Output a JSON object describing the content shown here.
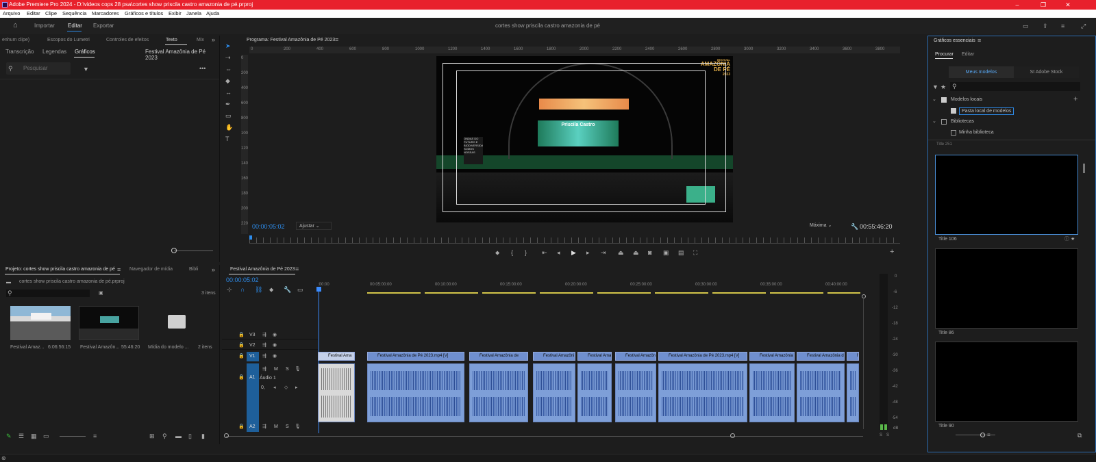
{
  "app": {
    "title": "Adobe Premiere Pro 2024 - D:\\videos cops 28 psa\\cortes show priscila castro amazonia de pé.prproj"
  },
  "menu": [
    "Arquivo",
    "Editar",
    "Clipe",
    "Sequência",
    "Marcadores",
    "Gráficos e títulos",
    "Exibir",
    "Janela",
    "Ajuda"
  ],
  "workspace": {
    "tabs": [
      "Importar",
      "Editar",
      "Exportar"
    ],
    "project_title": "cortes show priscila castro amazonia de pé"
  },
  "left_panel": {
    "tabs": [
      "enhum clipe)",
      "Escopos do Lumetri",
      "Controles de efeitos",
      "Texto",
      "Mix"
    ],
    "subtabs": [
      "Transcrição",
      "Legendas",
      "Gráficos"
    ],
    "sequence_name": "Festival Amazônia de Pé 2023",
    "search_placeholder": "Pesquisar"
  },
  "project_panel": {
    "tabs": [
      "Projeto: cortes show priscila castro amazonia de pé",
      "Navegador de mídia",
      "Bibli"
    ],
    "file": "cortes show priscila castro amazonia de pé.prproj",
    "count": "3 itens",
    "items": [
      {
        "name": "Festival Amaz...",
        "duration": "6:06:56:15"
      },
      {
        "name": "Festival Amazôn...",
        "duration": "55:46:20"
      },
      {
        "name": "Mídia do modelo ...",
        "duration": "2 itens"
      }
    ]
  },
  "program": {
    "title": "Programa: Festival Amazônia de Pé 2023",
    "timecode": "00:00:05:02",
    "fit": "Ajustar",
    "quality": "Máxima",
    "duration": "00:55:46:20",
    "ruler": [
      "0",
      "200",
      "400",
      "600",
      "800",
      "1000",
      "1200",
      "1400",
      "1600",
      "1800",
      "2000",
      "2200",
      "2400",
      "2600",
      "2800",
      "3000",
      "3200",
      "3400",
      "3600",
      "3800"
    ],
    "ruler_v": [
      "0",
      "200",
      "400",
      "600",
      "800",
      "1000",
      "1200",
      "1400",
      "1600",
      "1800",
      "2000",
      "2200"
    ],
    "logo_small": "FESTIVAL",
    "logo_main": "AMAZÔNIA",
    "logo_de": "DE PÉ",
    "logo_year": "2023",
    "stage_banner": "Priscila Castro",
    "side_text": "ONDAS DO FUTURO E BIODIVERSIDADE SOMOS NOSSAS"
  },
  "timeline": {
    "title": "Festival Amazônia de Pé 2023",
    "timecode": "00:00:05:02",
    "ruler": [
      ":00:00",
      "00:05:00:00",
      "00:10:00:00",
      "00:15:00:00",
      "00:20:00:00",
      "00:25:00:00",
      "00:30:00:00",
      "00:35:00:00",
      "00:40:00:00"
    ],
    "tracks": [
      "V3",
      "V2",
      "V1",
      "A1",
      "A2"
    ],
    "audio_label": "Áudio 1",
    "audio_value": "0,",
    "clips": [
      "Festival Ama",
      "Festival Amazônia de Pé 2023.mp4 [V]",
      "Festival Amazônia de",
      "Festival Amazôni",
      "Festival Amaz",
      "Festival Amazôn",
      "Festival Amazônia de Pé 2023.mp4 [V]",
      "Festival Amazônia",
      "Festival Amazônia d",
      "F"
    ]
  },
  "meters": {
    "scale": [
      "0",
      "-6",
      "-12",
      "-18",
      "-24",
      "-30",
      "-36",
      "-42",
      "-48",
      "-54",
      "dB"
    ],
    "solo": [
      "S",
      "S"
    ]
  },
  "essential_graphics": {
    "title": "Gráficos essenciais",
    "tabs": [
      "Procurar",
      "Editar"
    ],
    "toggle": [
      "Meus modelos",
      "Adobe Stock"
    ],
    "tree": [
      "Modelos locais",
      "Pasta local de modelos",
      "Bibliotecas",
      "Minha biblioteca"
    ],
    "templates": [
      "Title 251",
      "Title 106",
      "Title 86",
      "Title 90"
    ]
  },
  "colors": {
    "titlebar": "#e8212c",
    "accent": "#2d8ceb",
    "clip_video": "#6f8fcf",
    "clip_audio": "#7e9fd8",
    "playhead": "#3b8cff"
  }
}
